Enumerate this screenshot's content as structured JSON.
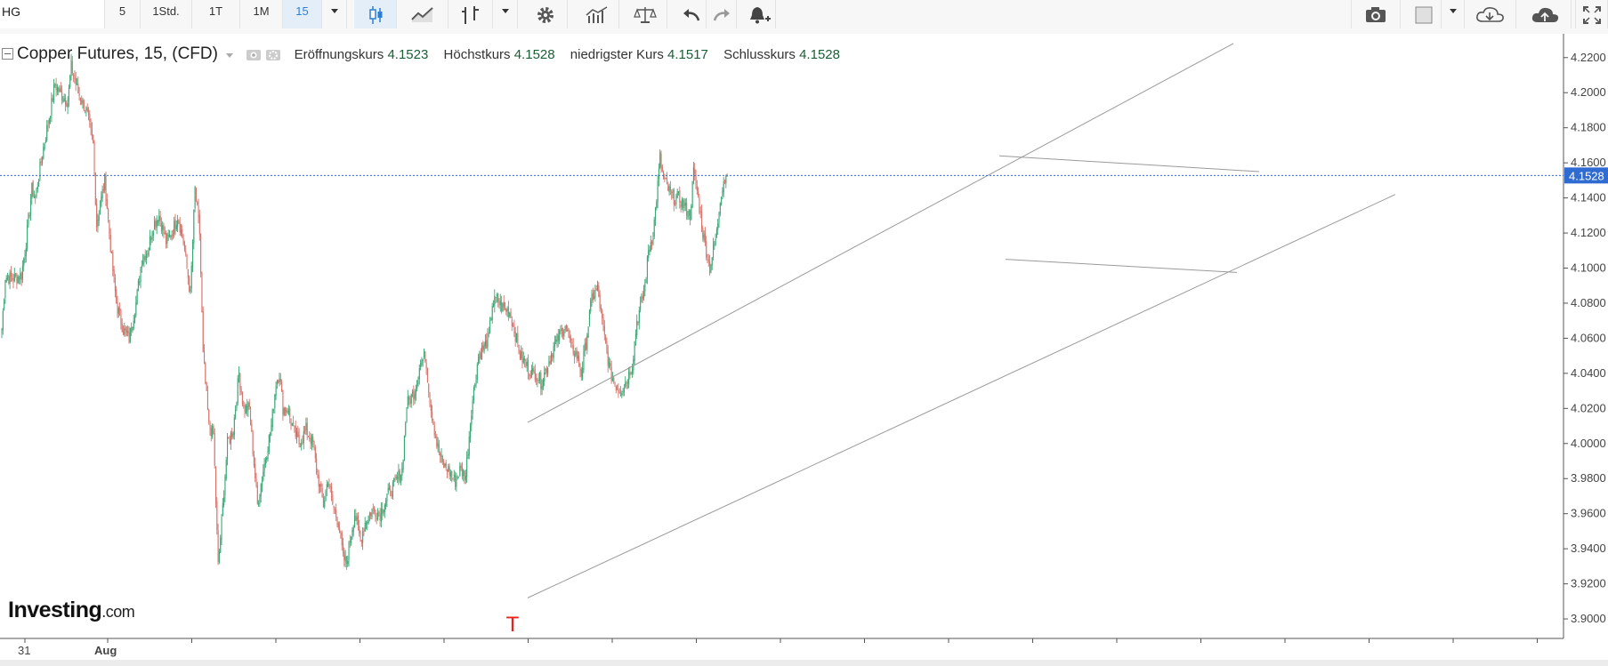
{
  "toolbar": {
    "symbol": "HG",
    "intervals": [
      "5",
      "1Std.",
      "1T",
      "1M",
      "15"
    ],
    "active_interval": "15",
    "icons": [
      "chevron-down-icon",
      "candlestick-icon",
      "line-chart-icon",
      "bar-chart-icon",
      "chevron-down-icon",
      "gear-icon",
      "indicators-icon",
      "compare-icon",
      "undo-icon",
      "redo-icon",
      "alert-icon",
      "camera-icon",
      "color-box-icon",
      "chevron-down-icon",
      "cloud-download-icon",
      "cloud-upload-icon",
      "fullscreen-icon"
    ]
  },
  "legend": {
    "instrument": "Copper Futures, 15, (CFD)",
    "open_label": "Eröffnungskurs",
    "open_value": "4.1523",
    "high_label": "Höchstkurs",
    "high_value": "4.1528",
    "low_label": "niedrigster Kurs",
    "low_value": "4.1517",
    "close_label": "Schlusskurs",
    "close_value": "4.1528"
  },
  "brand": {
    "name": "Investing",
    "suffix": ".com"
  },
  "marker": "T",
  "colors": {
    "up": "#3aa875",
    "down": "#d8726a",
    "price_line": "#2f6bd1",
    "trendline": "#9a9a9a",
    "marker": "#e8231f"
  },
  "chart_data": {
    "type": "candlestick",
    "title": "Copper Futures, 15, (CFD)",
    "y_ticks": [
      "4.2200",
      "4.2000",
      "4.1800",
      "4.1600",
      "4.1400",
      "4.1200",
      "4.1000",
      "4.0800",
      "4.0600",
      "4.0400",
      "4.0200",
      "4.0000",
      "3.9800",
      "3.9600",
      "3.9400",
      "3.9200",
      "3.9000"
    ],
    "ylim": [
      3.898,
      4.2285
    ],
    "x_tick_labels": [
      "31",
      "Aug"
    ],
    "current_price": 4.1528,
    "current_price_label": "4.1528",
    "anchors": [
      [
        0,
        4.065
      ],
      [
        3,
        4.095
      ],
      [
        10,
        4.094
      ],
      [
        17,
        4.096
      ],
      [
        21,
        4.115
      ],
      [
        26,
        4.145
      ],
      [
        29,
        4.14
      ],
      [
        35,
        4.165
      ],
      [
        42,
        4.19
      ],
      [
        46,
        4.205
      ],
      [
        50,
        4.2
      ],
      [
        57,
        4.195
      ],
      [
        60,
        4.215
      ],
      [
        66,
        4.2
      ],
      [
        73,
        4.19
      ],
      [
        79,
        4.17
      ],
      [
        82,
        4.125
      ],
      [
        89,
        4.15
      ],
      [
        95,
        4.105
      ],
      [
        99,
        4.08
      ],
      [
        105,
        4.065
      ],
      [
        110,
        4.06
      ],
      [
        116,
        4.08
      ],
      [
        121,
        4.105
      ],
      [
        126,
        4.11
      ],
      [
        131,
        4.125
      ],
      [
        136,
        4.13
      ],
      [
        142,
        4.115
      ],
      [
        147,
        4.12
      ],
      [
        152,
        4.13
      ],
      [
        157,
        4.115
      ],
      [
        163,
        4.085
      ],
      [
        167,
        4.145
      ],
      [
        171,
        4.12
      ],
      [
        174,
        4.05
      ],
      [
        179,
        4.01
      ],
      [
        183,
        4.005
      ],
      [
        187,
        3.93
      ],
      [
        190,
        3.955
      ],
      [
        195,
        4.0
      ],
      [
        200,
        4.008
      ],
      [
        205,
        4.04
      ],
      [
        209,
        4.02
      ],
      [
        214,
        4.02
      ],
      [
        221,
        3.965
      ],
      [
        226,
        3.985
      ],
      [
        233,
        4.01
      ],
      [
        237,
        4.035
      ],
      [
        240,
        4.04
      ],
      [
        243,
        4.02
      ],
      [
        247,
        4.02
      ],
      [
        252,
        4.008
      ],
      [
        257,
        4.0
      ],
      [
        263,
        4.008
      ],
      [
        269,
        4.0
      ],
      [
        272,
        3.985
      ],
      [
        278,
        3.965
      ],
      [
        282,
        3.98
      ],
      [
        286,
        3.965
      ],
      [
        291,
        3.955
      ],
      [
        295,
        3.935
      ],
      [
        298,
        3.932
      ],
      [
        301,
        3.945
      ],
      [
        305,
        3.96
      ],
      [
        310,
        3.945
      ],
      [
        314,
        3.955
      ],
      [
        320,
        3.962
      ],
      [
        327,
        3.96
      ],
      [
        333,
        3.97
      ],
      [
        338,
        3.975
      ],
      [
        342,
        3.98
      ],
      [
        346,
        3.985
      ],
      [
        350,
        4.022
      ],
      [
        357,
        4.03
      ],
      [
        361,
        4.045
      ],
      [
        366,
        4.05
      ],
      [
        371,
        4.02
      ],
      [
        376,
        4.0
      ],
      [
        381,
        3.988
      ],
      [
        386,
        3.985
      ],
      [
        392,
        3.978
      ],
      [
        396,
        3.985
      ],
      [
        401,
        3.982
      ],
      [
        406,
        4.02
      ],
      [
        412,
        4.05
      ],
      [
        417,
        4.055
      ],
      [
        421,
        4.06
      ],
      [
        424,
        4.08
      ],
      [
        428,
        4.082
      ],
      [
        432,
        4.078
      ],
      [
        439,
        4.075
      ],
      [
        443,
        4.065
      ],
      [
        448,
        4.05
      ],
      [
        453,
        4.045
      ],
      [
        458,
        4.04
      ],
      [
        462,
        4.04
      ],
      [
        466,
        4.035
      ],
      [
        472,
        4.045
      ],
      [
        477,
        4.055
      ],
      [
        481,
        4.06
      ],
      [
        487,
        4.068
      ],
      [
        492,
        4.055
      ],
      [
        497,
        4.05
      ],
      [
        501,
        4.04
      ],
      [
        505,
        4.058
      ],
      [
        510,
        4.083
      ],
      [
        515,
        4.088
      ],
      [
        521,
        4.06
      ],
      [
        526,
        4.04
      ],
      [
        531,
        4.033
      ],
      [
        535,
        4.03
      ],
      [
        540,
        4.036
      ],
      [
        545,
        4.045
      ],
      [
        549,
        4.07
      ],
      [
        553,
        4.08
      ],
      [
        556,
        4.09
      ],
      [
        559,
        4.11
      ],
      [
        563,
        4.12
      ],
      [
        566,
        4.14
      ],
      [
        569,
        4.163
      ],
      [
        572,
        4.15
      ],
      [
        576,
        4.145
      ],
      [
        580,
        4.14
      ],
      [
        585,
        4.14
      ],
      [
        590,
        4.135
      ],
      [
        595,
        4.13
      ],
      [
        598,
        4.155
      ],
      [
        602,
        4.14
      ],
      [
        606,
        4.12
      ],
      [
        609,
        4.11
      ],
      [
        612,
        4.1
      ],
      [
        615,
        4.11
      ],
      [
        618,
        4.12
      ],
      [
        621,
        4.14
      ],
      [
        624,
        4.15
      ],
      [
        627,
        4.153
      ]
    ]
  }
}
